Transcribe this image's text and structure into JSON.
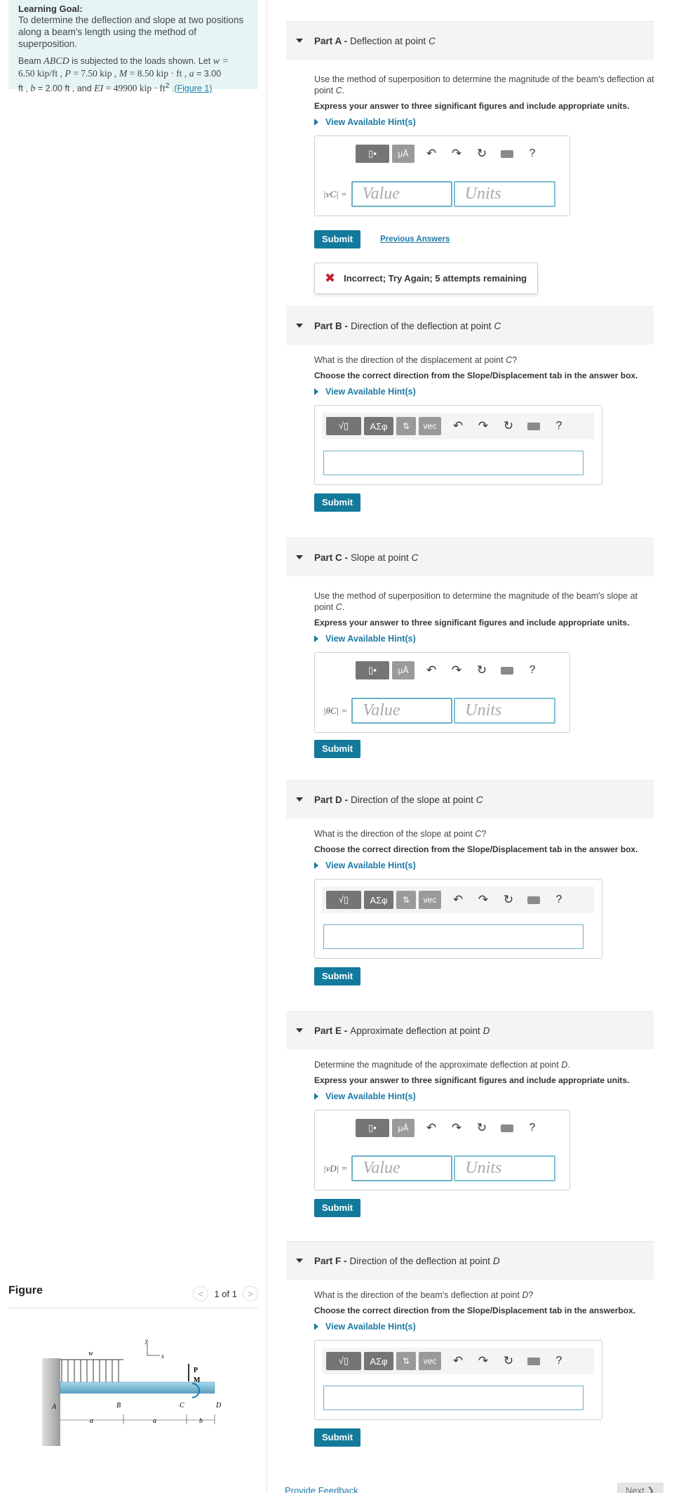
{
  "learning_goal": {
    "title": "Learning Goal:",
    "text": "To determine the deflection and slope at two positions along a beam's length using the method of superposition.",
    "p1": "Beam ",
    "beam": "ABCD",
    "p2": " is subjected to the loads shown. Let ",
    "w_eq": "w =",
    "w_val": "6.50 kip/ft , ",
    "P_eq": "P",
    "P_val": " = 7.50 kip , ",
    "M_eq": "M",
    "M_val": " = 8.50 kip · ft , ",
    "a_eq": "a",
    "a_val": " = 3.00",
    "line3a": "ft , ",
    "b_eq": "b",
    "b_val": " = 2.00 ft , and ",
    "EI_eq": "EI",
    "EI_val": " = 49900 kip · ft",
    "EI_sup": "2",
    "dot": " .",
    "figure_link": "(Figure 1)"
  },
  "figure": {
    "title": "Figure",
    "pager": "1 of 1",
    "prev": "<",
    "next": ">",
    "labels": {
      "A": "A",
      "B": "B",
      "C": "C",
      "D": "D",
      "w": "w",
      "P": "P",
      "M": "M",
      "a1": "a",
      "a2": "a",
      "b": "b",
      "x": "x",
      "y": "y"
    }
  },
  "toolbar": {
    "mu": "μÅ",
    "sqrt": "√▯",
    "greek": "ΑΣφ",
    "arrows": "⇅",
    "vec": "vec",
    "help": "?",
    "undo": "↶",
    "redo": "↷",
    "reset": "↻"
  },
  "common": {
    "hint": "View Available Hint(s)",
    "submit": "Submit",
    "value_ph": "Value",
    "units_ph": "Units",
    "prev_answers": "Previous Answers",
    "instr_sig": "Express your answer to three significant figures and include appropriate units."
  },
  "parts": {
    "A": {
      "label": "Part A -",
      "title": "Deflection at point ",
      "pt": "C",
      "q1": "Use the method of superposition to determine the magnitude of the beam's deflection at point ",
      "q_pt": "C",
      "q2": ".",
      "var": "|vC| =",
      "feedback": "Incorrect; Try Again; 5 attempts remaining"
    },
    "B": {
      "label": "Part B -",
      "title": "Direction of the deflection at point ",
      "pt": "C",
      "q1": "What is the direction of the displacement at point ",
      "q_pt": "C",
      "q2": "?",
      "instr": "Choose the correct direction from the Slope/Displacement tab in the answer box."
    },
    "C": {
      "label": "Part C -",
      "title": "Slope at point ",
      "pt": "C",
      "q1": "Use the method of superposition to determine the magnitude of the beam's slope at point ",
      "q_pt": "C",
      "q2": ".",
      "var": "|θC| ="
    },
    "D": {
      "label": "Part D -",
      "title": "Direction of the slope at point ",
      "pt": "C",
      "q1": "What is the direction of the slope at point ",
      "q_pt": "C",
      "q2": "?",
      "instr": "Choose the correct direction from the Slope/Displacement tab in the answer box."
    },
    "E": {
      "label": "Part E -",
      "title": "Approximate deflection at point ",
      "pt": "D",
      "q1": "Determine the magnitude of the approximate deflection at point ",
      "q_pt": "D",
      "q2": ".",
      "var": "|vD| ="
    },
    "F": {
      "label": "Part F -",
      "title": "Direction of the deflection at point ",
      "pt": "D",
      "q1": "What is the direction of the beam's deflection at point ",
      "q_pt": "D",
      "q2": "?",
      "instr": "Choose the correct direction from the Slope/Displacement tab in the answerbox."
    }
  },
  "footer": {
    "provide_feedback": "Provide Feedback",
    "next": "Next ❯"
  }
}
